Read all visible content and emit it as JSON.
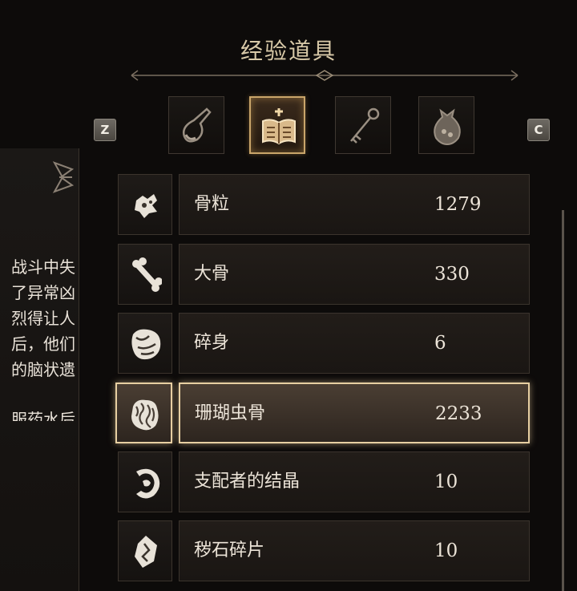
{
  "header": {
    "title": "经验道具"
  },
  "keys": {
    "left": "Z",
    "right": "C"
  },
  "tabs": [
    {
      "icon": "flask-icon",
      "active": false
    },
    {
      "icon": "tome-icon",
      "active": true
    },
    {
      "icon": "key-icon",
      "active": false
    },
    {
      "icon": "pouch-icon",
      "active": false
    }
  ],
  "description": {
    "lines": [
      "战斗中失",
      "了异常凶",
      "烈得让人",
      "后，他们",
      "的脑状遗",
      "服药水后"
    ]
  },
  "items": [
    {
      "name": "骨粒",
      "quantity": "1279",
      "icon": "bone-fragment-icon"
    },
    {
      "name": "大骨",
      "quantity": "330",
      "icon": "large-bone-icon"
    },
    {
      "name": "碎身",
      "quantity": "6",
      "icon": "crushed-body-icon"
    },
    {
      "name": "珊瑚虫骨",
      "quantity": "2233",
      "icon": "coral-bone-icon",
      "selected": true
    },
    {
      "name": "支配者的结晶",
      "quantity": "10",
      "icon": "crystal-icon"
    },
    {
      "name": "秽石碎片",
      "quantity": "10",
      "icon": "stone-shard-icon"
    }
  ]
}
